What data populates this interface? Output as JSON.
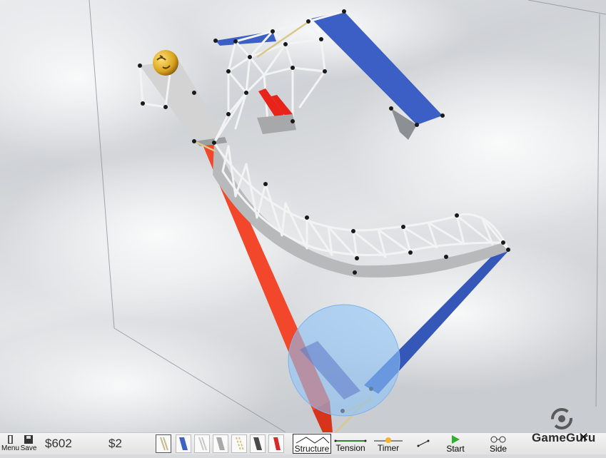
{
  "toolbar": {
    "menu_label": "Menu",
    "save_label": "Save",
    "budget": "$602",
    "cost": "$2",
    "materials": [
      {
        "name": "rope",
        "color": "#c8b98c"
      },
      {
        "name": "road",
        "color": "#3e63c4"
      },
      {
        "name": "steel-thin",
        "color": "#bdbdbd"
      },
      {
        "name": "steel",
        "color": "#9e9e9e"
      },
      {
        "name": "cable",
        "color": "#d8c27a"
      },
      {
        "name": "beam",
        "color": "#4a4a4a"
      },
      {
        "name": "hydraulic",
        "color": "#d92a2a"
      }
    ],
    "modes": [
      {
        "id": "structure",
        "label": "Structure"
      },
      {
        "id": "tension",
        "label": "Tension"
      },
      {
        "id": "timer",
        "label": "Timer"
      }
    ],
    "start_label": "Start",
    "side_label": "Side",
    "brand": "GameGuru",
    "close_symbol": "✕"
  },
  "colors": {
    "road": "#3b5fc4",
    "hydraulic": "#f04a2a",
    "truss": "#eeeeee",
    "deck": "#b9b9b9",
    "sphere": "#8ec3f7",
    "ball": "#e4b62b"
  }
}
